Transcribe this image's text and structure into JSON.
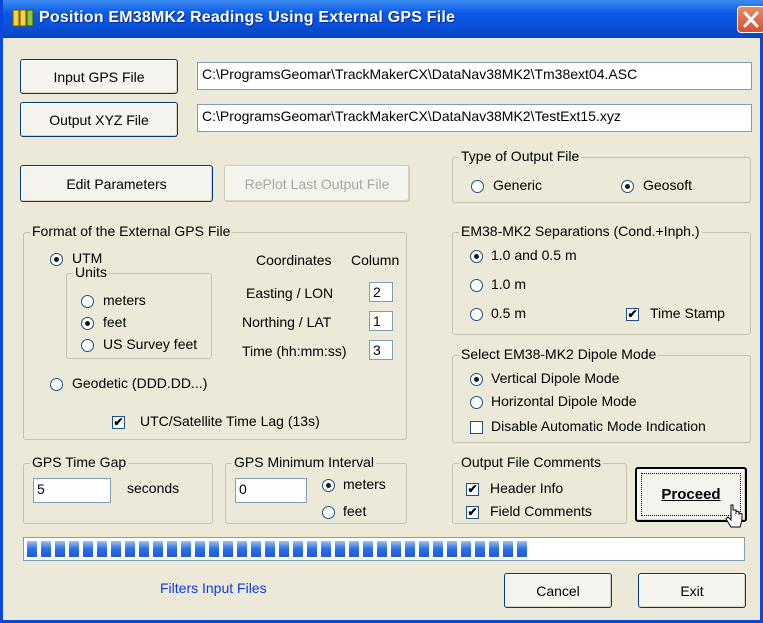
{
  "window": {
    "title": "Position EM38MK2 Readings Using External GPS File",
    "close_icon": "close-icon",
    "title_color": "#ffffff",
    "titlebar_color": "#0a50d8"
  },
  "files": {
    "input_button": "Input GPS File",
    "input_path": "C:\\ProgramsGeomar\\TrackMakerCX\\DataNav38MK2\\Tm38ext04.ASC",
    "output_button": "Output XYZ File",
    "output_path": "C:\\ProgramsGeomar\\TrackMakerCX\\DataNav38MK2\\TestExt15.xyz"
  },
  "actions": {
    "edit_parameters": "Edit Parameters",
    "replot_last": "RePlot Last Output File"
  },
  "output_type": {
    "title": "Type of Output File",
    "generic": "Generic",
    "geosoft": "Geosoft",
    "selected": "Geosoft"
  },
  "gps_format": {
    "title": "Format of the External GPS File",
    "utm": "UTM",
    "units_title": "Units",
    "meters": "meters",
    "feet": "feet",
    "us_survey_feet": "US Survey feet",
    "selected_unit": "feet",
    "geodetic": "Geodetic (DDD.DD...)",
    "coordinates_header": "Coordinates",
    "column_header": "Column",
    "easting_label": "Easting / LON",
    "easting_col": "2",
    "northing_label": "Northing / LAT",
    "northing_col": "1",
    "time_label": "Time (hh:mm:ss)",
    "time_col": "3",
    "utc_lag": "UTC/Satellite Time Lag (13s)",
    "utc_checked": true
  },
  "separations": {
    "title": "EM38-MK2 Separations (Cond.+Inph.)",
    "opt1": "1.0 and 0.5 m",
    "opt2": "1.0 m",
    "opt3": "0.5 m",
    "selected": "1.0 and 0.5 m",
    "time_stamp": "Time Stamp",
    "time_stamp_checked": true
  },
  "dipole": {
    "title": "Select EM38-MK2 Dipole Mode",
    "vertical": "Vertical Dipole Mode",
    "horizontal": "Horizontal Dipole Mode",
    "selected": "Vertical Dipole Mode",
    "disable_auto": "Disable Automatic Mode Indication",
    "disable_auto_checked": false
  },
  "time_gap": {
    "title": "GPS Time Gap",
    "value": "5",
    "unit": "seconds"
  },
  "min_interval": {
    "title": "GPS Minimum Interval",
    "value": "0",
    "meters": "meters",
    "feet": "feet",
    "selected": "meters"
  },
  "comments": {
    "title": "Output File Comments",
    "header_info": "Header Info",
    "field_comments": "Field Comments",
    "header_checked": true,
    "field_checked": true
  },
  "proceed": "Proceed",
  "progress": {
    "fraction": 0.71,
    "segments": 36
  },
  "status": {
    "text": "Filters Input Files",
    "color": "#0a3ad8"
  },
  "footer": {
    "cancel": "Cancel",
    "exit": "Exit"
  }
}
